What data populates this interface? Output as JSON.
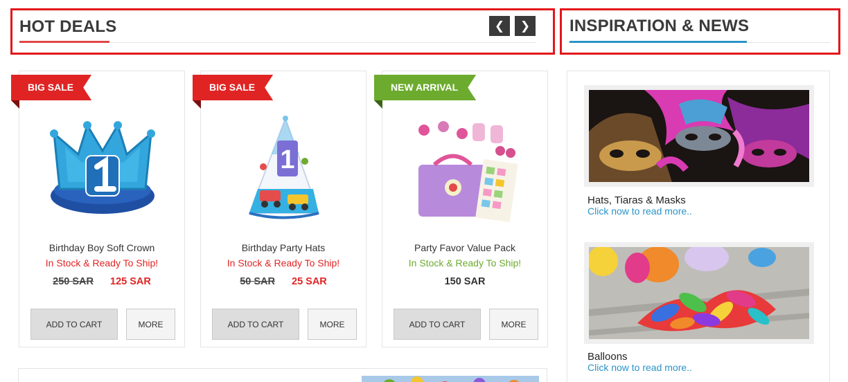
{
  "hot_deals": {
    "title": "HOT DEALS",
    "prev_label": "❮",
    "next_label": "❯"
  },
  "news_header": {
    "title": "INSPIRATION & NEWS"
  },
  "products": [
    {
      "ribbon": "BIG SALE",
      "ribbon_type": "sale",
      "name": "Birthday Boy Soft Crown",
      "stock": "In Stock & Ready To Ship!",
      "old_price": "250 SAR",
      "price": "125 SAR",
      "add_to_cart": "ADD TO CART",
      "more": "MORE"
    },
    {
      "ribbon": "BIG SALE",
      "ribbon_type": "sale",
      "name": "Birthday Party Hats",
      "stock": "In Stock & Ready To Ship!",
      "old_price": "50 SAR",
      "price": "25 SAR",
      "add_to_cart": "ADD TO CART",
      "more": "MORE"
    },
    {
      "ribbon": "NEW ARRIVAL",
      "ribbon_type": "new",
      "name": "Party Favor Value Pack",
      "stock": "In Stock & Ready To Ship!",
      "price": "150 SAR",
      "add_to_cart": "ADD TO CART",
      "more": "MORE"
    }
  ],
  "news": [
    {
      "title": "Hats, Tiaras & Masks",
      "link": "Click now to read more.."
    },
    {
      "title": "Balloons",
      "link": "Click now to read more.."
    }
  ],
  "colors": {
    "accent_red": "#e02424",
    "accent_green": "#6cab2e",
    "link_blue": "#2a93c7",
    "highlight_border": "#e3161b"
  }
}
